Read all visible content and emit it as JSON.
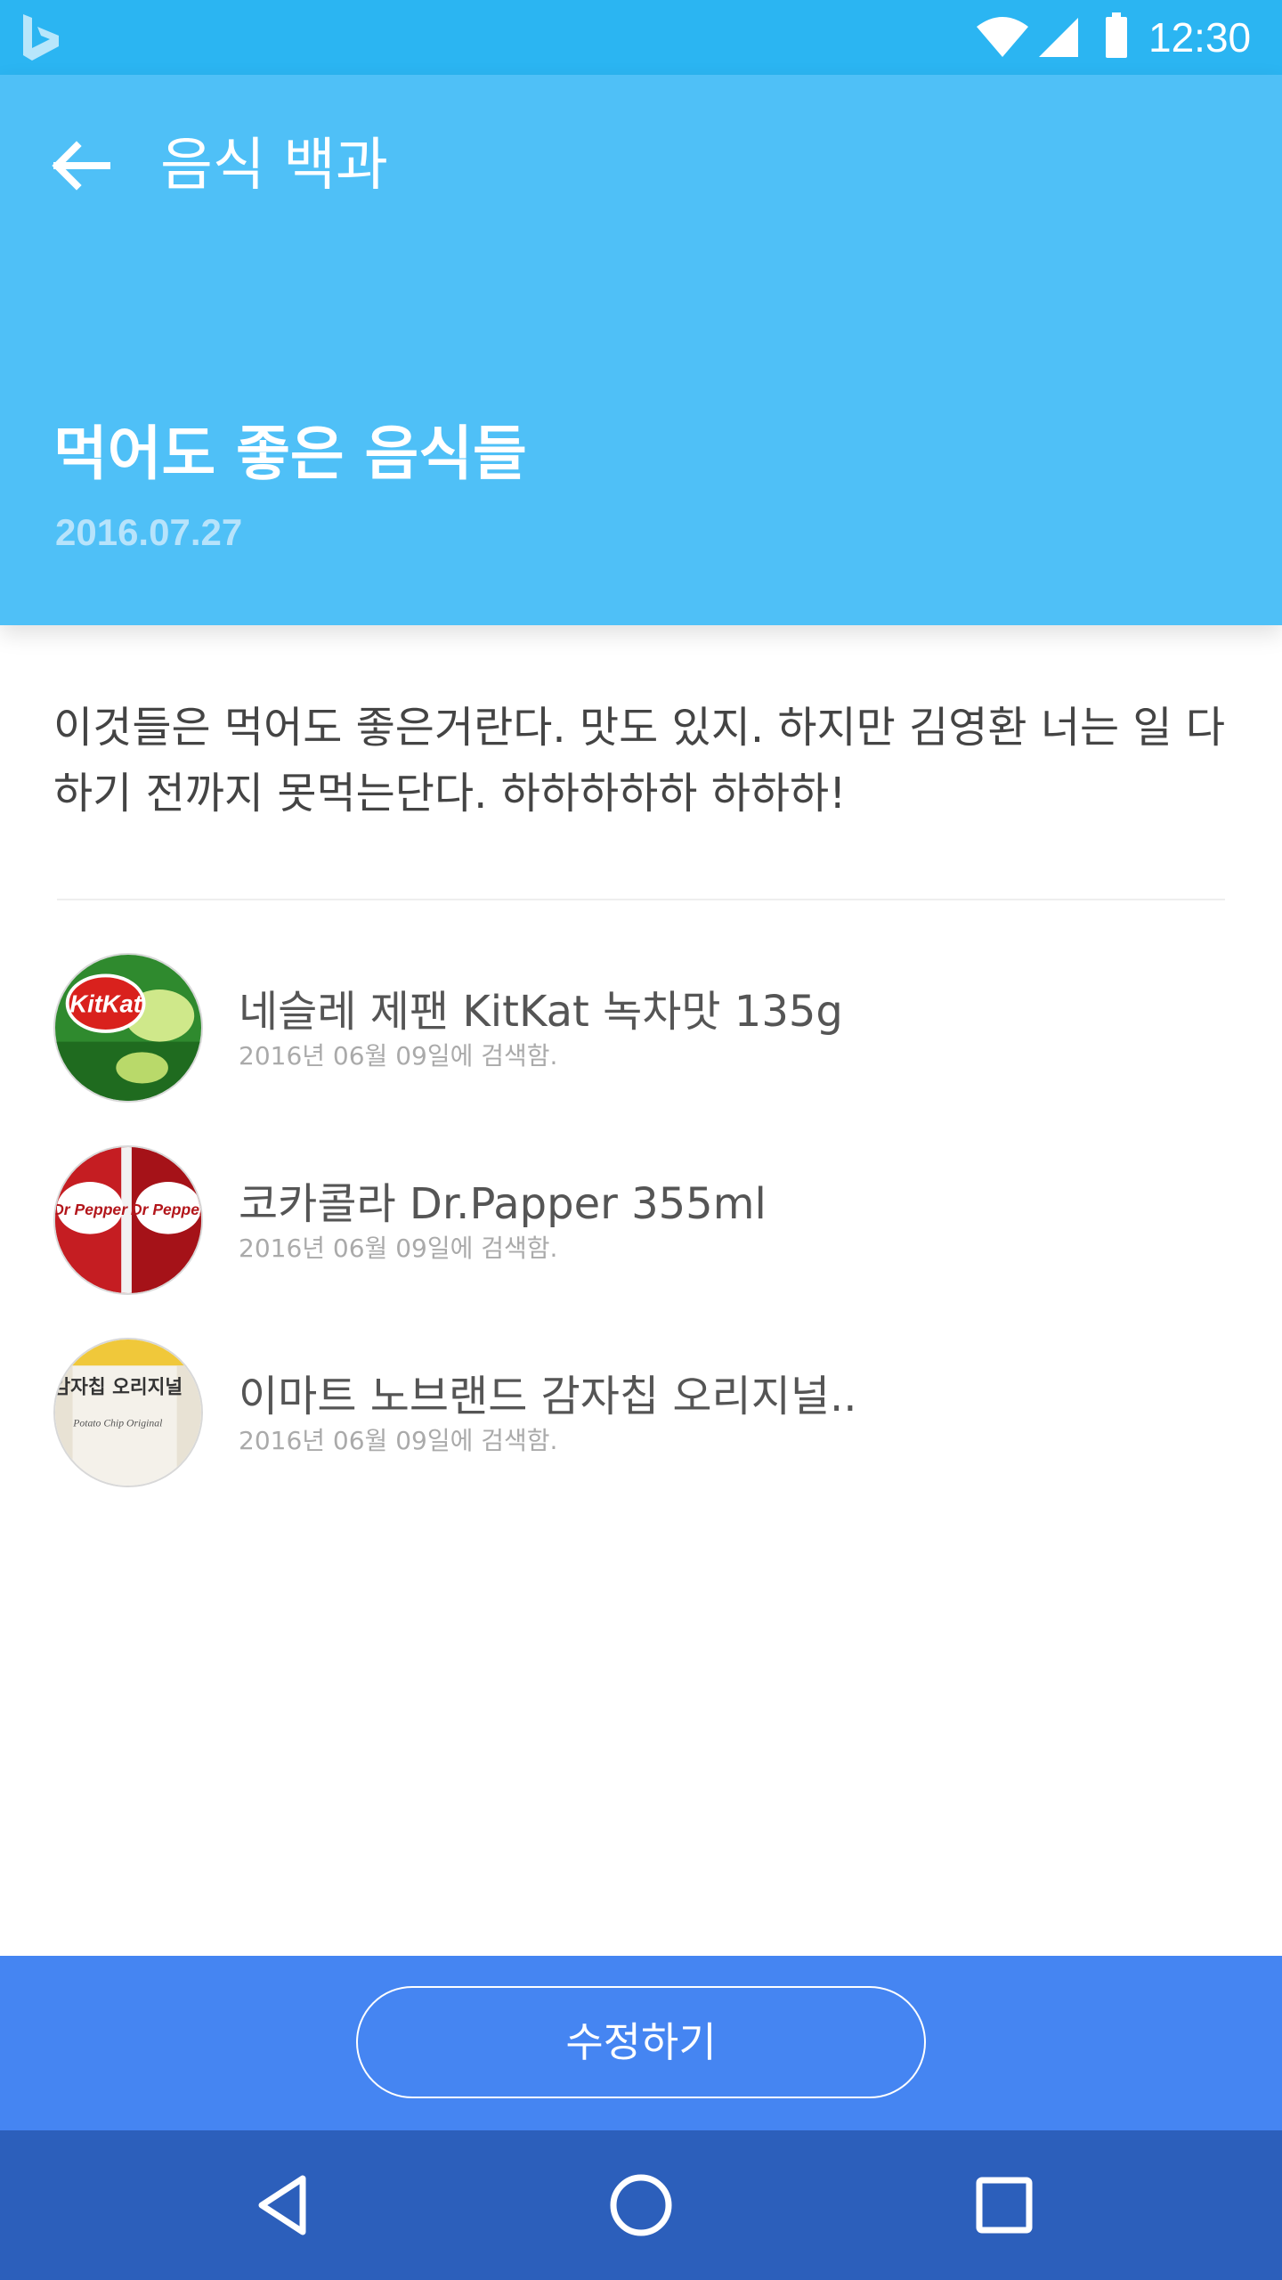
{
  "status_bar": {
    "time": "12:30",
    "icons": [
      "bing-logo-icon",
      "wifi-icon",
      "cell-signal-icon",
      "battery-icon"
    ]
  },
  "header": {
    "back_icon": "arrow-left-icon",
    "app_title": "음식 백과",
    "note_title": "먹어도 좋은 음식들",
    "note_date": "2016.07.27"
  },
  "description": "이것들은 먹어도 좋은거란다. 맛도 있지. 하지만 김영환 너는 일 다 하기 전까지 못먹는단다. 하하하하하 하하하!",
  "food_items": [
    {
      "name": "네슬레 제팬 KitKat 녹차맛 135g",
      "searched": "2016년 06월 09일에 검색함."
    },
    {
      "name": "코카콜라 Dr.Papper 355ml",
      "searched": "2016년 06월 09일에 검색함."
    },
    {
      "name": "이마트 노브랜드 감자칩 오리지널..",
      "searched": "2016년 06월 09일에 검색함."
    }
  ],
  "thumbnail_text": {
    "kitkat_logo": "KitKat",
    "drpepper_logo": "Dr Pepper",
    "chip_bag_label": "감자칩 오리지널",
    "chip_bag_subtitle": "Potato Chip Original"
  },
  "action": {
    "edit_label": "수정하기"
  },
  "nav_bar": {
    "icons": [
      "back-triangle-icon",
      "home-circle-icon",
      "recents-square-icon"
    ]
  },
  "colors": {
    "status_bar": "#2bb5f2",
    "header": "#4fc0f7",
    "action_bar": "#4585f2",
    "nav_bar": "#2c5fbb"
  }
}
